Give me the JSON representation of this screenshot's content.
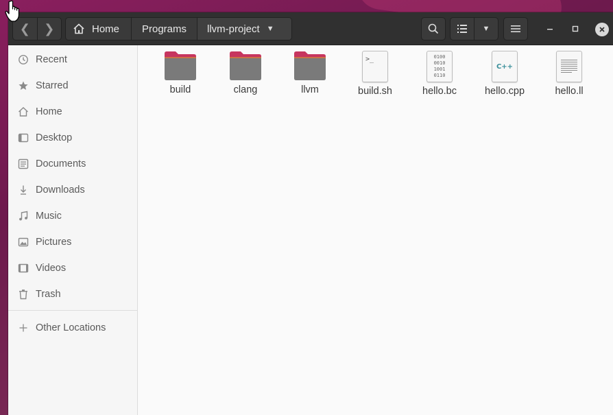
{
  "toolbar": {
    "back_label": "❮",
    "forward_label": "❯"
  },
  "path": {
    "home": "Home",
    "programs": "Programs",
    "current": "llvm-project"
  },
  "sidebar": {
    "items": [
      {
        "label": "Recent",
        "icon": "clock-icon"
      },
      {
        "label": "Starred",
        "icon": "star-icon"
      },
      {
        "label": "Home",
        "icon": "home-icon"
      },
      {
        "label": "Desktop",
        "icon": "desktop-icon"
      },
      {
        "label": "Documents",
        "icon": "document-icon"
      },
      {
        "label": "Downloads",
        "icon": "download-icon"
      },
      {
        "label": "Music",
        "icon": "music-icon"
      },
      {
        "label": "Pictures",
        "icon": "picture-icon"
      },
      {
        "label": "Videos",
        "icon": "video-icon"
      },
      {
        "label": "Trash",
        "icon": "trash-icon"
      }
    ],
    "other": {
      "label": "Other Locations",
      "icon": "plus-icon"
    }
  },
  "files": [
    {
      "name": "build",
      "type": "folder"
    },
    {
      "name": "clang",
      "type": "folder"
    },
    {
      "name": "llvm",
      "type": "folder"
    },
    {
      "name": "build.sh",
      "type": "script",
      "glyph": ">_"
    },
    {
      "name": "hello.bc",
      "type": "binary",
      "glyph": "0100 0010 1001 0110"
    },
    {
      "name": "hello.cpp",
      "type": "cpp",
      "glyph": "C++"
    },
    {
      "name": "hello.ll",
      "type": "text"
    }
  ],
  "colors": {
    "folder_tab": "#c7355f",
    "folder_body": "#7a7a7a",
    "cpp_text": "#3a8f9a"
  }
}
